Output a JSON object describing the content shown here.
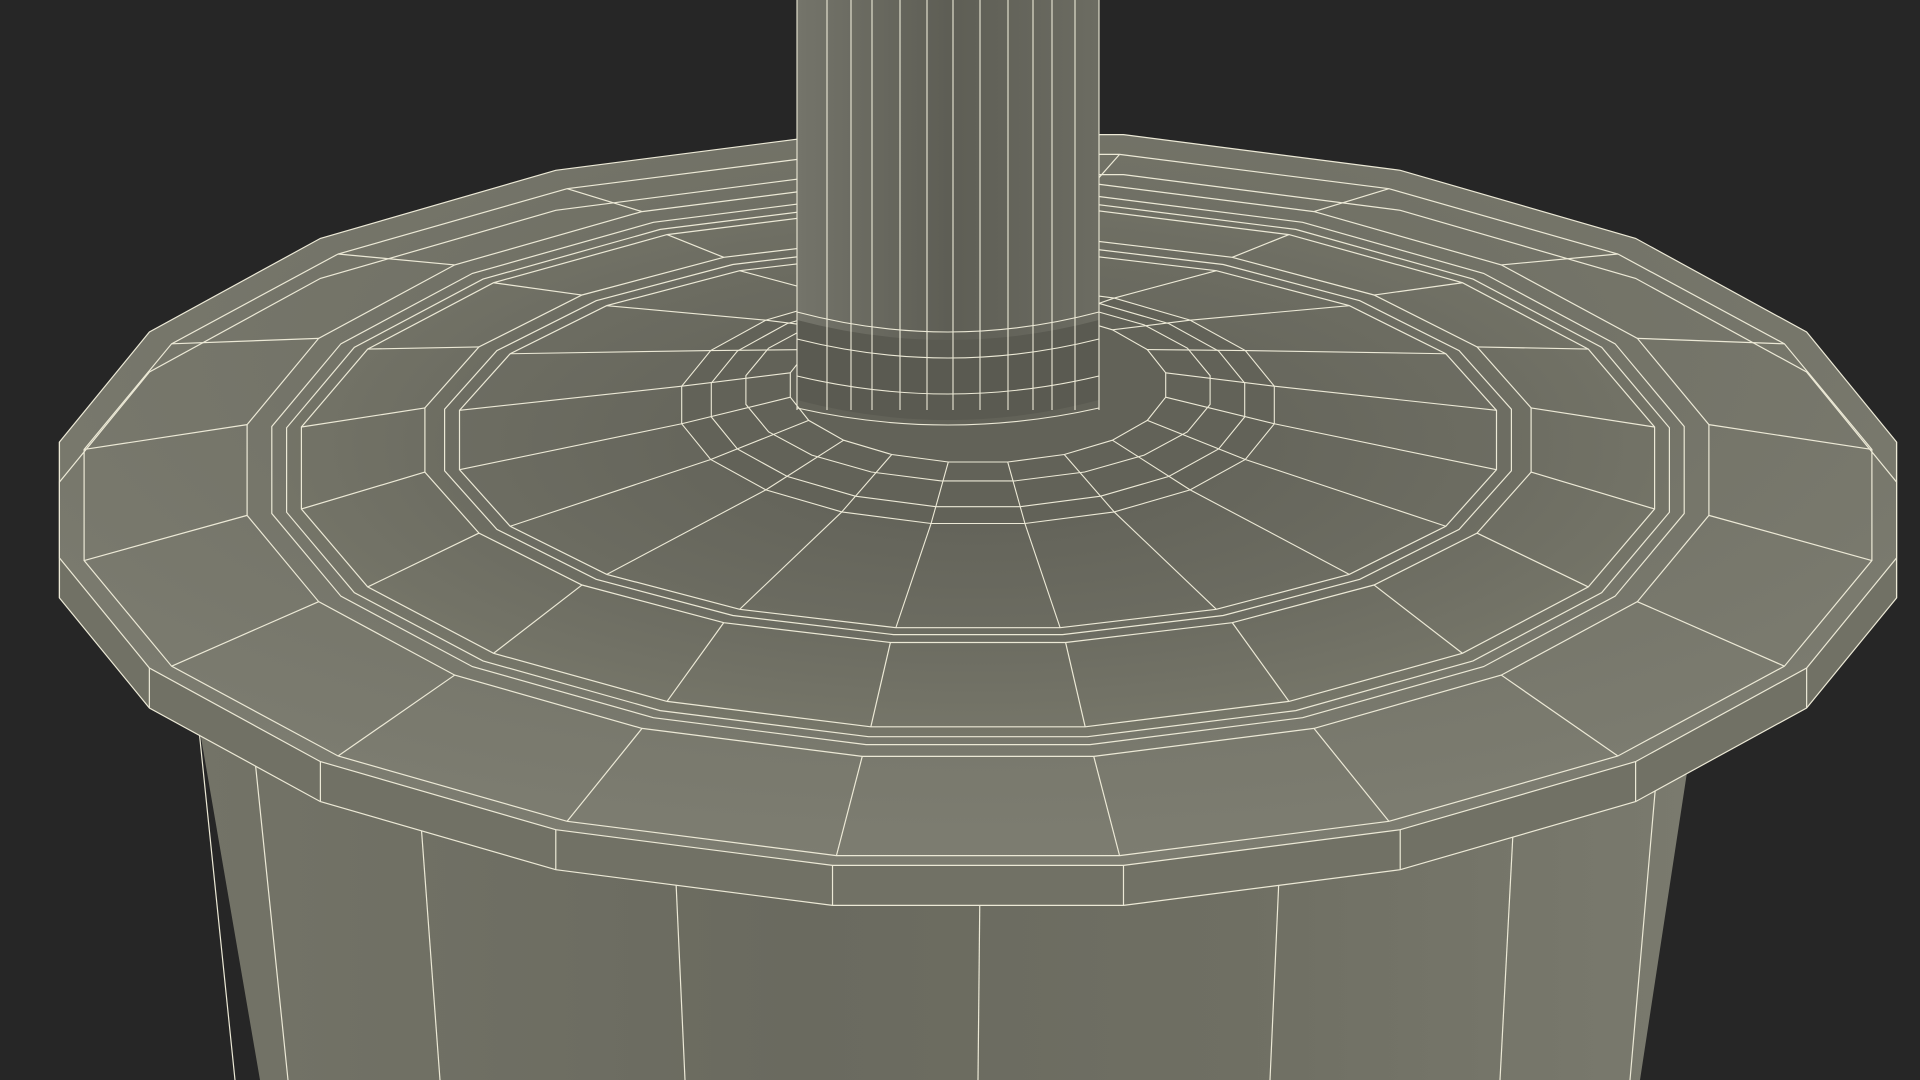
{
  "scene": {
    "subject": "wireframe-mesh-render",
    "colors": {
      "background": "#262626",
      "surface_light": "#7f7f72",
      "surface_mid": "#727266",
      "surface_dark": "#5c5c52",
      "wire": "#ece9d6"
    }
  }
}
